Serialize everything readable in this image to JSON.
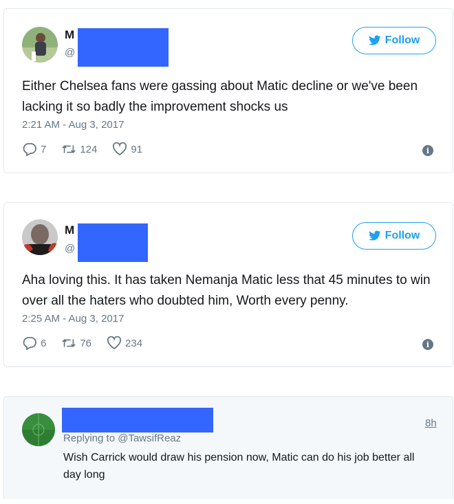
{
  "tweets": [
    {
      "name_initial": "M",
      "handle_prefix": "@",
      "follow_label": "Follow",
      "text": "Either Chelsea fans were gassing about Matic decline or we've been lacking it so badly the improvement shocks us",
      "timestamp": "2:21 AM - Aug 3, 2017",
      "replies": "7",
      "retweets": "124",
      "likes": "91"
    },
    {
      "name_initial": "M",
      "handle_prefix": "@",
      "follow_label": "Follow",
      "text": "Aha loving this. It has taken Nemanja Matic less that 45 minutes to win over all the haters who doubted him, Worth every penny.",
      "timestamp": "2:25 AM - Aug 3, 2017",
      "replies": "6",
      "retweets": "76",
      "likes": "234"
    }
  ],
  "reply_card": {
    "relative_time": "8h",
    "replying_to": "Replying to @TawsifReaz",
    "text": "Wish Carrick would draw his pension now, Matic can do his job better all day long"
  },
  "colors": {
    "accent": "#1da1f2",
    "redaction": "#3366ff",
    "muted": "#657786"
  }
}
